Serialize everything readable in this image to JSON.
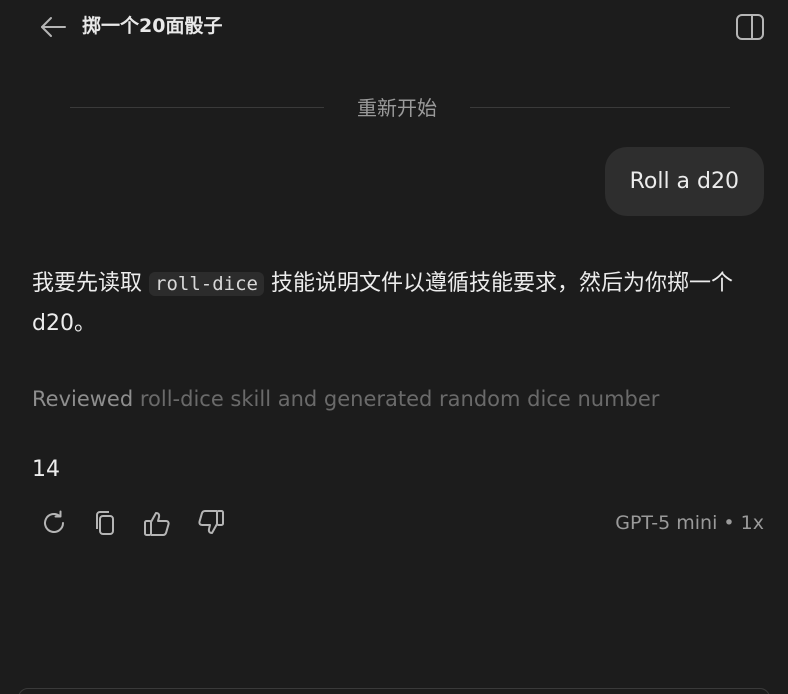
{
  "header": {
    "title": "掷一个20面骰子",
    "back_icon": "arrow-left-icon",
    "sidebar_icon": "sidebar-toggle-icon"
  },
  "divider": {
    "label": "重新开始"
  },
  "user_message": {
    "text": "Roll a d20"
  },
  "assistant_message": {
    "text_before_code": "我要先读取 ",
    "code": "roll-dice",
    "text_after_code": " 技能说明文件以遵循技能要求，然后为你掷一个 d20。",
    "reviewed_verb": "Reviewed",
    "reviewed_detail": " roll-dice skill and generated random dice number",
    "result": "14"
  },
  "actions": [
    {
      "name": "regenerate",
      "icon": "refresh-icon"
    },
    {
      "name": "copy",
      "icon": "copy-icon"
    },
    {
      "name": "like",
      "icon": "thumbs-up-icon"
    },
    {
      "name": "dislike",
      "icon": "thumbs-down-icon"
    }
  ],
  "model_info": {
    "text": "GPT-5 mini • 1x"
  },
  "colors": {
    "background": "#1c1c1c",
    "bubble": "#2e2e2e",
    "text": "#ececec",
    "muted": "#9a9a9a"
  }
}
